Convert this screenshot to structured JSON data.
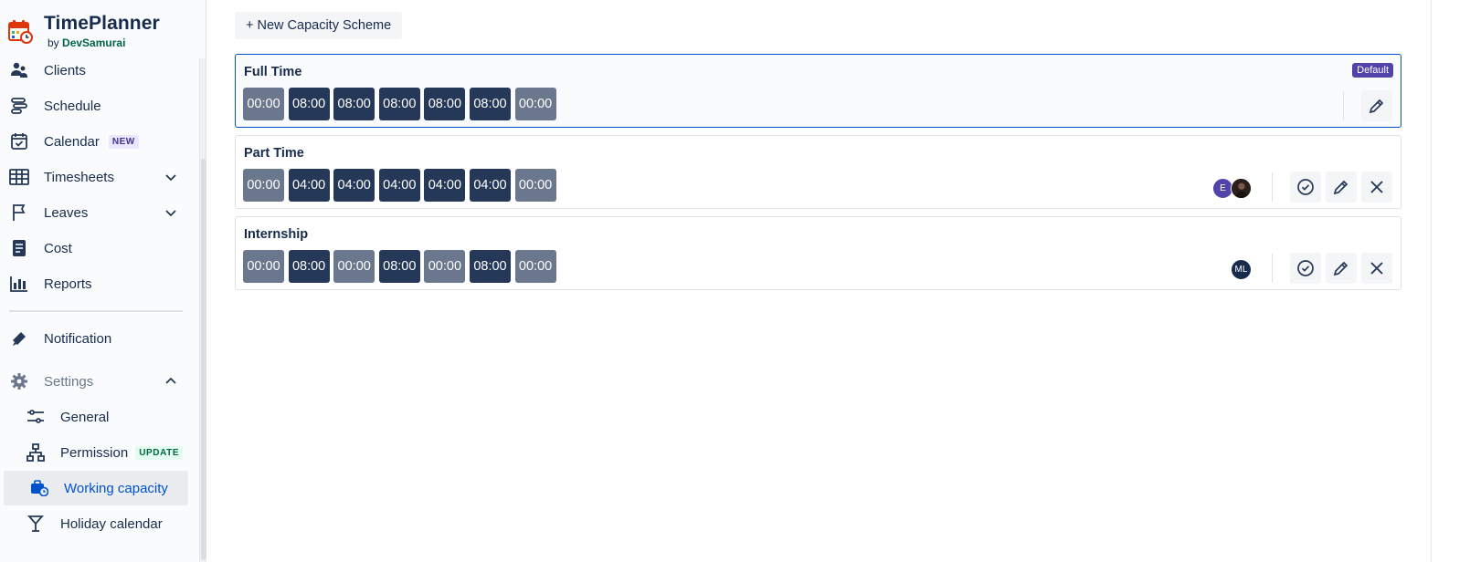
{
  "brand": {
    "title": "TimePlanner",
    "by": "by",
    "company": "DevSamurai"
  },
  "sidebar": {
    "items": [
      {
        "label": "Clients",
        "icon": "users-icon"
      },
      {
        "label": "Schedule",
        "icon": "schedule-icon"
      },
      {
        "label": "Calendar",
        "icon": "calendar-check-icon",
        "badge": "NEW"
      },
      {
        "label": "Timesheets",
        "icon": "table-grid-icon"
      },
      {
        "label": "Leaves",
        "icon": "flag-icon"
      },
      {
        "label": "Cost",
        "icon": "receipt-icon"
      },
      {
        "label": "Reports",
        "icon": "bar-chart-icon"
      },
      {
        "label": "Notification",
        "icon": "megaphone-icon"
      },
      {
        "label": "Settings",
        "icon": "gear-icon"
      }
    ],
    "settings_sub": [
      {
        "label": "General",
        "icon": "sliders-icon"
      },
      {
        "label": "Permission",
        "icon": "hierarchy-icon",
        "badge": "UPDATE"
      },
      {
        "label": "Working capacity",
        "icon": "briefcase-clock-icon",
        "selected": true
      },
      {
        "label": "Holiday calendar",
        "icon": "cocktail-icon"
      }
    ]
  },
  "toolbar": {
    "new_scheme": "+ New Capacity Scheme"
  },
  "schemes": [
    {
      "name": "Full Time",
      "default_label": "Default",
      "days": [
        "00:00",
        "08:00",
        "08:00",
        "08:00",
        "08:00",
        "08:00",
        "00:00"
      ]
    },
    {
      "name": "Part Time",
      "days": [
        "00:00",
        "04:00",
        "04:00",
        "04:00",
        "04:00",
        "04:00",
        "00:00"
      ],
      "avatars": [
        "E"
      ]
    },
    {
      "name": "Internship",
      "days": [
        "00:00",
        "08:00",
        "00:00",
        "08:00",
        "00:00",
        "08:00",
        "00:00"
      ],
      "avatars": [
        "ML"
      ]
    }
  ],
  "colors": {
    "workday": "#253858",
    "offday": "#6b778c",
    "accent": "#0052cc",
    "default_badge": "#5243aa"
  }
}
